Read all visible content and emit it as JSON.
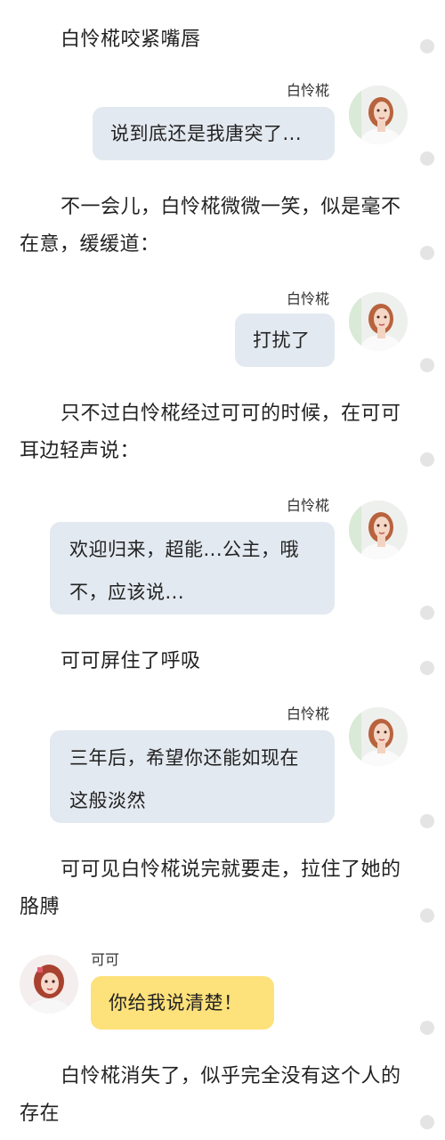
{
  "story": {
    "narration": [
      "白怜椛咬紧嘴唇",
      "不一会儿，白怜椛微微一笑，似是毫不在意，缓缓道：",
      "只不过白怜椛经过可可的时候，在可可耳边轻声说：",
      "可可屏住了呼吸",
      "可可见白怜椛说完就要走，拉住了她的胳膊",
      "白怜椛消失了，似乎完全没有这个人的存在"
    ],
    "messages": [
      {
        "speaker": "白怜椛",
        "text": "说到底还是我唐突了...",
        "side": "right",
        "color": "#e3e9f0"
      },
      {
        "speaker": "白怜椛",
        "text": "打扰了",
        "side": "right",
        "color": "#e3e9f0"
      },
      {
        "speaker": "白怜椛",
        "text": "欢迎归来，超能...公主，哦不，应该说...",
        "side": "right",
        "color": "#e3e9f0"
      },
      {
        "speaker": "白怜椛",
        "text": "三年后，希望你还能如现在这般淡然",
        "side": "right",
        "color": "#e3e9f0"
      },
      {
        "speaker": "可可",
        "text": "你给我说清楚！",
        "side": "left",
        "color": "#fde17a"
      }
    ],
    "avatars": {
      "bailianhua": "avatar-woman-white-dress",
      "keke": "avatar-girl-red-hair"
    }
  }
}
